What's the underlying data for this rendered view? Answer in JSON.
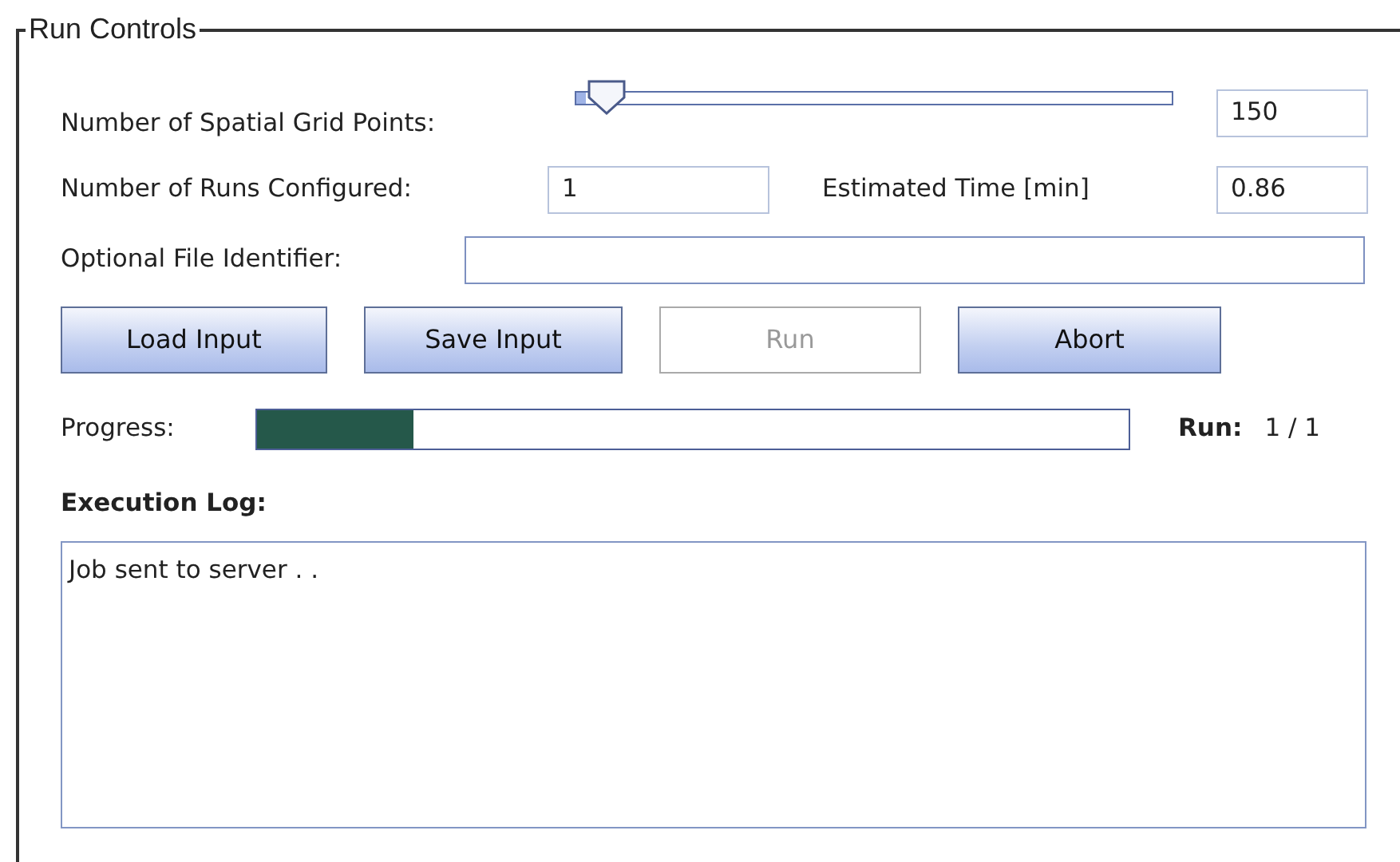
{
  "group_title": "Run Controls",
  "grid_points": {
    "label": "Number of Spatial Grid Points:",
    "level": 0.05,
    "value": "150"
  },
  "runs": {
    "label": "Number of Runs Configured:",
    "value": "1"
  },
  "estimated_time": {
    "label": "Estimated Time [min]",
    "value": "0.86"
  },
  "file_identifier": {
    "label": "Optional File Identifier:"
  },
  "buttons": [
    {
      "label": "Load Input",
      "disabled": false
    },
    {
      "label": "Save Input",
      "disabled": false
    },
    {
      "label": "Run",
      "disabled": true
    },
    {
      "label": "Abort",
      "disabled": false
    }
  ],
  "progress": {
    "label": "Progress:",
    "level": 0.18,
    "run_label": "Run:",
    "run_value": "1 / 1"
  },
  "log": {
    "label": "Execution Log:",
    "text": "Job sent to server . ."
  }
}
